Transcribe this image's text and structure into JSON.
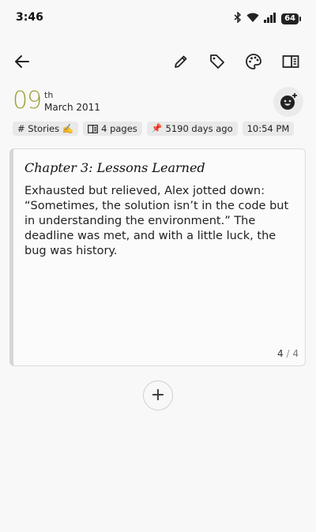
{
  "status_bar": {
    "time": "3:46",
    "battery": "64"
  },
  "toolbar": {
    "back_icon": "arrow-left-icon",
    "edit_icon": "pencil-icon",
    "tag_icon": "tag-icon",
    "palette_icon": "palette-icon",
    "view_icon": "book-view-icon"
  },
  "entry": {
    "day": "09",
    "day_suffix": "th",
    "month_year": "March 2011",
    "chips": {
      "category": "# Stories ✍️",
      "pages": "4 pages",
      "age": "5190 days ago",
      "time": "10:54 PM"
    }
  },
  "card": {
    "title": "Chapter 3: Lessons Learned",
    "body": "Exhausted but relieved, Alex jotted down: “Sometimes, the solution isn’t in the code but in understanding the environment.” The deadline was met, and with a little luck, the bug was history.",
    "page_current": "4",
    "page_separator": "/",
    "page_total": "4"
  },
  "add_button": {
    "label": "+"
  }
}
